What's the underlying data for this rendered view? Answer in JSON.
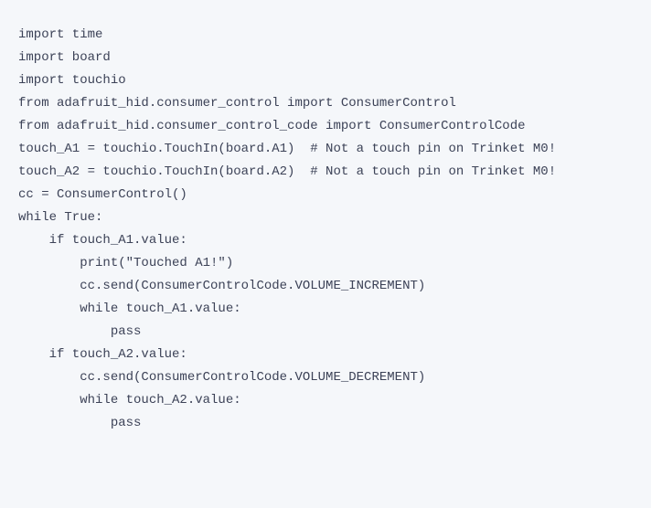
{
  "code": {
    "line1": "import time",
    "line2": "import board",
    "line3": "import touchio",
    "line4": "from adafruit_hid.consumer_control import ConsumerControl",
    "line5": "from adafruit_hid.consumer_control_code import ConsumerControlCode",
    "line6": "",
    "line7": "",
    "line8": "touch_A1 = touchio.TouchIn(board.A1)  # Not a touch pin on Trinket M0!",
    "line9": "touch_A2 = touchio.TouchIn(board.A2)  # Not a touch pin on Trinket M0!",
    "line10": "",
    "line11": "cc = ConsumerControl()",
    "line12": "",
    "line13": "while True:",
    "line14": "    if touch_A1.value:",
    "line15": "        print(\"Touched A1!\")",
    "line16": "        cc.send(ConsumerControlCode.VOLUME_INCREMENT)",
    "line17": "        while touch_A1.value:",
    "line18": "            pass",
    "line19": "    if touch_A2.value:",
    "line20": "        cc.send(ConsumerControlCode.VOLUME_DECREMENT)",
    "line21": "        while touch_A2.value:",
    "line22": "            pass"
  }
}
